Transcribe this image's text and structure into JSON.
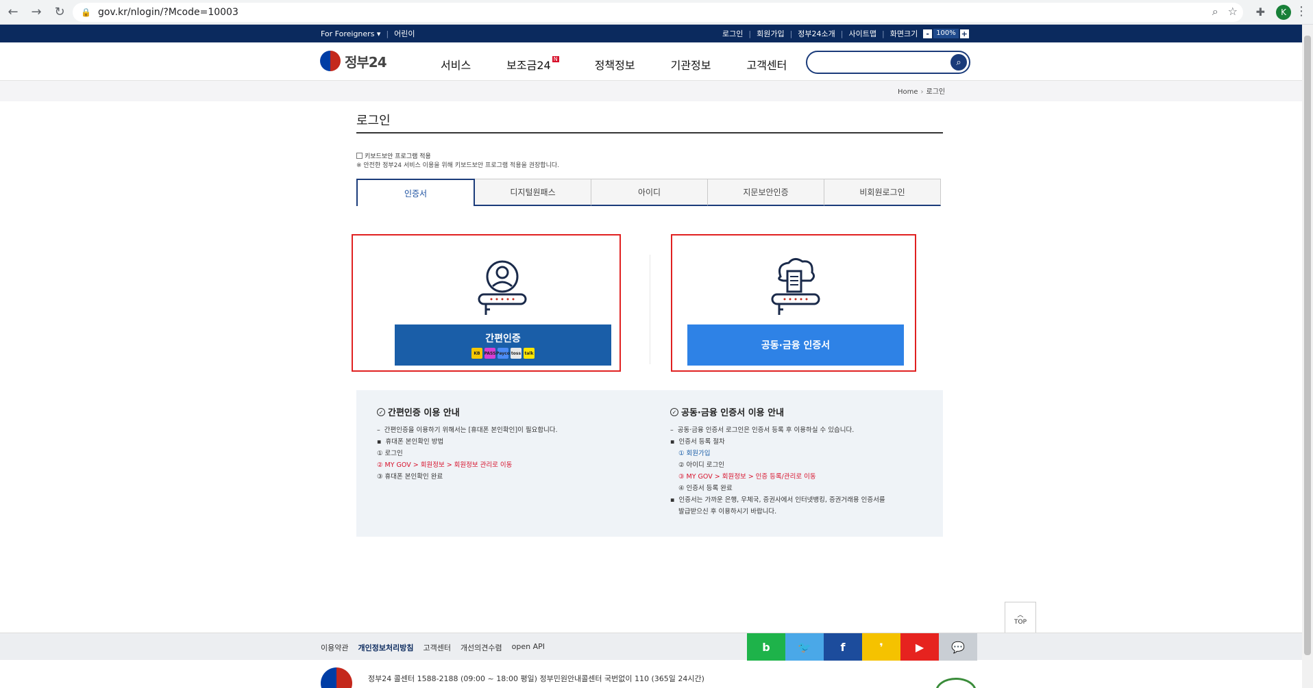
{
  "browser": {
    "url": "gov.kr/nlogin/?Mcode=10003"
  },
  "util": {
    "foreigners": "For Foreigners ▾",
    "kids": "어린이",
    "login": "로그인",
    "signup": "회원가입",
    "intro": "정부24소개",
    "sitemap": "사이트맵",
    "screen_size": "화면크기",
    "zoom_minus": "-",
    "zoom_value": "100%",
    "zoom_plus": "+"
  },
  "header": {
    "logo_text": "정부24",
    "nav": [
      "서비스",
      "보조금24",
      "정책정보",
      "기관정보",
      "고객센터"
    ],
    "new_badge": "N",
    "search_placeholder": ""
  },
  "breadcrumb": {
    "home": "Home",
    "arrow": "›",
    "current": "로그인"
  },
  "page": {
    "title": "로그인",
    "keyboard_label": "키보드보안 프로그램 적용",
    "keyboard_note": "※ 안전한 정부24 서비스 이용을 위해 키보드보안 프로그램 적용을 권장합니다."
  },
  "tabs": [
    "인증서",
    "디지털원패스",
    "아이디",
    "지문보안인증",
    "비회원로그인"
  ],
  "cards": {
    "simple_auth_label": "간편인증",
    "cert_label": "공동·금융 인증서",
    "brands": [
      {
        "name": "KB",
        "color": "#f6c700"
      },
      {
        "name": "PASS",
        "color": "#d63fd3"
      },
      {
        "name": "Payco",
        "color": "#4b8bf5"
      },
      {
        "name": "toss",
        "color": "#e8e8e8"
      },
      {
        "name": "talk",
        "color": "#fee500"
      }
    ]
  },
  "info": {
    "simple": {
      "title": "간편인증 이용 안내",
      "lines": [
        "간편인증을 이용하기 위해서는 [휴대폰 본인확인]이 필요합니다.",
        "휴대폰 본인확인 방법",
        "① 로그인",
        "② MY GOV > 회원정보 > 회원정보 관리로 이동",
        "③ 휴대폰 본인확인 완료"
      ]
    },
    "cert": {
      "title": "공동·금융 인증서 이용 안내",
      "lines": [
        "공동·금융 인증서 로그인은 인증서 등록 후 이용하실 수 있습니다.",
        "인증서 등록 절차",
        "① 회원가입",
        "② 아이디 로그인",
        "③ MY GOV > 회원정보 > 인증 등록/관리로 이동",
        "④ 인증서 등록 완료",
        "인증서는 가까운 은행, 우체국, 증권사에서 인터넷뱅킹, 증권거래용 인증서를",
        "발급받으신 후 이용하시기 바랍니다."
      ]
    }
  },
  "top_button": "TOP",
  "footer": {
    "links": [
      "이용약관",
      "개인정보처리방침",
      "고객센터",
      "개선의견수렴",
      "open API"
    ],
    "sns": [
      {
        "label": "b",
        "color": "#1eb34a"
      },
      {
        "label": "🐦",
        "color": "#4aa8e8"
      },
      {
        "label": "f",
        "color": "#1c4c9c"
      },
      {
        "label": "❜",
        "color": "#f5c200"
      },
      {
        "label": "▶",
        "color": "#e6231f"
      },
      {
        "label": "💬",
        "color": "#c9ced4"
      }
    ],
    "call_center": "정부24 콜센터 1588-2188 (09:00 ~ 18:00 평일) 정부민원안내콜센터 국번없이 110 (365일 24시간)"
  }
}
